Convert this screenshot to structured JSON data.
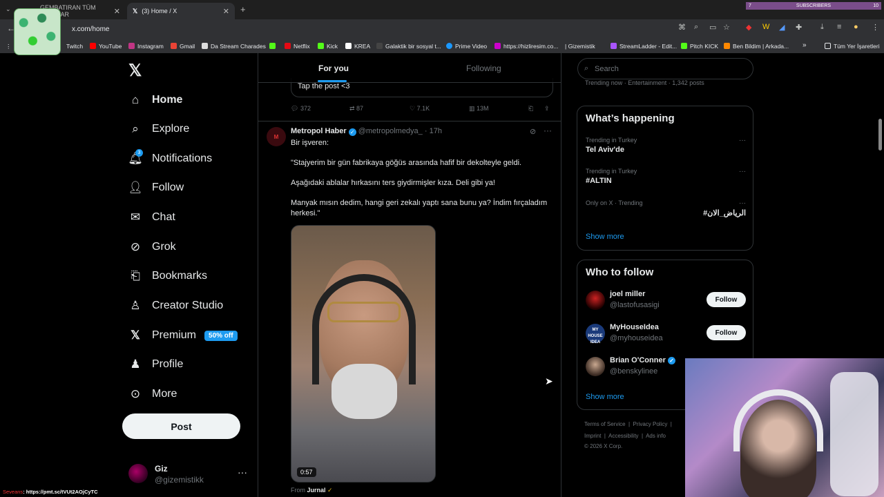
{
  "browser": {
    "tabs": [
      {
        "label": "GEMBATIRAN TÜM POSTLAR",
        "active": false
      },
      {
        "label": "(3) Home / X",
        "active": true
      }
    ],
    "new_tab": "+",
    "url": "x.com/home",
    "subscribers_label": "SUBSCRIBERS",
    "subscribers_left": "7",
    "subscribers_count": "10",
    "bookmarks": [
      "Twitch",
      "YouTube",
      "Instagram",
      "Gmail",
      "Da Stream Charades",
      "",
      "Netflix",
      "Kick",
      "KREA",
      "Galaktik bir sosyal t...",
      "Prime Video",
      "https://hizliresim.co...",
      "| Gizemistik",
      "StreamLadder - Edit...",
      "Pitch KICK",
      "Ben Bildim | Arkada..."
    ],
    "bookmarks_overflow": "»",
    "bookmarks_folder": "Tüm Yer İşaretleri"
  },
  "nav": {
    "items": [
      {
        "label": "Home",
        "icon": "home-icon"
      },
      {
        "label": "Explore",
        "icon": "search-icon"
      },
      {
        "label": "Notifications",
        "icon": "bell-icon"
      },
      {
        "label": "Follow",
        "icon": "follow-icon"
      },
      {
        "label": "Chat",
        "icon": "mail-icon"
      },
      {
        "label": "Grok",
        "icon": "grok-icon"
      },
      {
        "label": "Bookmarks",
        "icon": "bookmark-icon"
      },
      {
        "label": "Creator Studio",
        "icon": "creator-icon"
      },
      {
        "label": "Premium",
        "icon": "x-icon"
      },
      {
        "label": "Profile",
        "icon": "profile-icon"
      },
      {
        "label": "More",
        "icon": "more-icon"
      }
    ],
    "notif_count": "3",
    "premium_badge": "50% off",
    "post_button": "Post",
    "account": {
      "name": "Giz",
      "handle": "@gizemistikk"
    }
  },
  "feed": {
    "tabs": [
      "For you",
      "Following"
    ],
    "prev_post": {
      "quote_text": "Tap the post <3",
      "replies": "372",
      "reposts": "87",
      "likes": "7.1K",
      "views": "13M"
    },
    "post": {
      "avatar_text": "M",
      "author": "Metropol Haber",
      "handle": "@metropolmedya_",
      "time": "· 17h",
      "lines": [
        "Bir işveren:",
        "\"Stajyerim bir gün fabrikaya göğüs arasında hafif bir dekolteyle geldi.",
        "Aşağıdaki ablalar hırkasını ters giydirmişler kıza. Deli gibi ya!",
        "Manyak mısın dedim, hangi geri zekalı yaptı sana bunu ya? İndim fırçaladım herkesi.\""
      ],
      "video_time": "0:57",
      "from_label": "From",
      "from_source": "Jurnal"
    }
  },
  "right": {
    "search_placeholder": "Search",
    "top_trend_meta": "Trending now · Entertainment · 1,342 posts",
    "whats_happening": "What’s happening",
    "trends": [
      {
        "context": "Trending in Turkey",
        "topic": "Tel Aviv'de"
      },
      {
        "context": "Trending in Turkey",
        "topic": "#ALTIN"
      },
      {
        "context": "Only on X · Trending",
        "topic": "#الرياض_الان"
      }
    ],
    "show_more": "Show more",
    "who_to_follow": "Who to follow",
    "suggestions": [
      {
        "name": "joel miller",
        "handle": "@lastofusasigi",
        "button": "Follow"
      },
      {
        "name": "MyHouseIdea",
        "handle": "@myhouseidea",
        "button": "Follow"
      },
      {
        "name": "Brian O'Conner",
        "handle": "@benskylinee",
        "button": ""
      }
    ],
    "footer_row1": [
      "Terms of Service",
      "Privacy Policy"
    ],
    "footer_row2": [
      "Imprint",
      "Accessibility",
      "Ads info"
    ],
    "copyright": "© 2026 X Corp."
  },
  "stream": {
    "chat_user": "Seveans",
    "chat_link": ": https://pmt.sc/tVUt2AOjCyTC"
  },
  "colors": {
    "accent": "#1d9bf0",
    "bg": "#000000",
    "muted": "#71767b"
  }
}
